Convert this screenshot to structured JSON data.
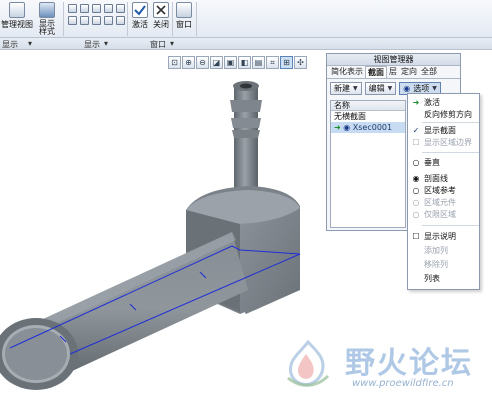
{
  "ribbon": {
    "manage_view_label": "管理视图",
    "display_style_label": "显示\n样式",
    "activate_label": "激活",
    "close_label": "关闭",
    "window_label": "窗口",
    "groups": {
      "display_left": "显示",
      "display": "显示",
      "window": "窗口"
    }
  },
  "view_manager": {
    "title": "视图管理器",
    "tabs": [
      "简化表示",
      "截面",
      "层",
      "定向",
      "全部"
    ],
    "active_tab_index": 1,
    "new_label": "新建",
    "edit_label": "编辑",
    "options_label": "选项",
    "list_header": "名称",
    "rows": [
      "无横截面",
      "Xsec0001"
    ]
  },
  "context_menu": {
    "items": [
      {
        "label": "激活",
        "mark": "arrow",
        "disabled": false
      },
      {
        "label": "反向修剪方向",
        "mark": "",
        "disabled": false
      },
      {
        "label": "显示截面",
        "mark": "check",
        "disabled": false
      },
      {
        "label": "显示区域边界",
        "mark": "box",
        "disabled": true
      },
      {
        "label": "垂直",
        "mark": "radio",
        "disabled": false
      },
      {
        "label": "剖面线",
        "mark": "radio-on",
        "disabled": false
      },
      {
        "label": "区域参考",
        "mark": "radio",
        "disabled": false
      },
      {
        "label": "区域元件",
        "mark": "radio",
        "disabled": true
      },
      {
        "label": "仅限区域",
        "mark": "radio",
        "disabled": true
      },
      {
        "label": "显示说明",
        "mark": "box",
        "disabled": false
      },
      {
        "label": "添加列",
        "mark": "",
        "disabled": true
      },
      {
        "label": "移除列",
        "mark": "",
        "disabled": true
      },
      {
        "label": "列表",
        "mark": "",
        "disabled": false
      }
    ]
  },
  "watermark": {
    "text": "野火论坛",
    "url": "www.proewildfire.cn"
  },
  "colors": {
    "model": "#7d858d",
    "section_line": "#1f2fd6",
    "accent": "#3a6ea5"
  }
}
